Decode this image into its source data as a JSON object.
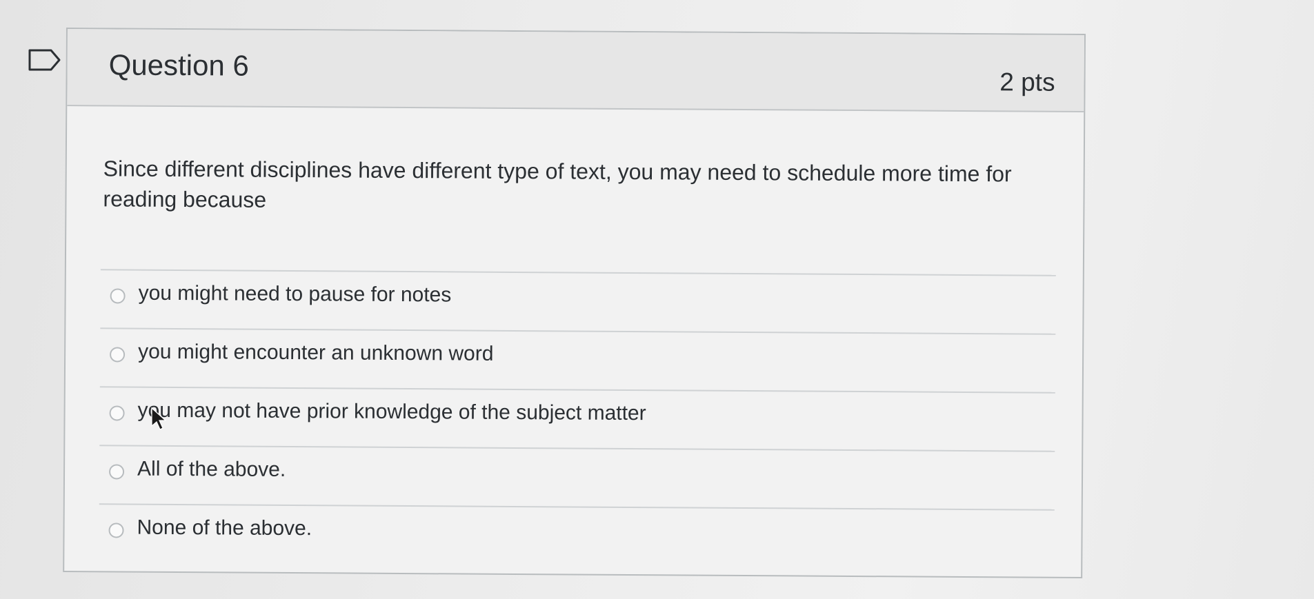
{
  "question": {
    "title": "Question 6",
    "points": "2 pts",
    "text": "Since different disciplines have different type of text,  you may need to schedule more time for reading because",
    "answers": [
      {
        "label": "you might need to pause for notes",
        "selected": false
      },
      {
        "label": "you might encounter an unknown word",
        "selected": false
      },
      {
        "label": "you may not have prior knowledge of the subject matter",
        "selected": false
      },
      {
        "label": "All of the above.",
        "selected": false
      },
      {
        "label": "None of the above.",
        "selected": false
      }
    ]
  },
  "icons": {
    "flag": "flag-icon",
    "cursor": "mouse-pointer-icon",
    "radio": "radio-button-icon"
  },
  "colors": {
    "text": "#2b2f33",
    "header_bg": "#e6e6e6",
    "border": "#b8bcbe"
  }
}
